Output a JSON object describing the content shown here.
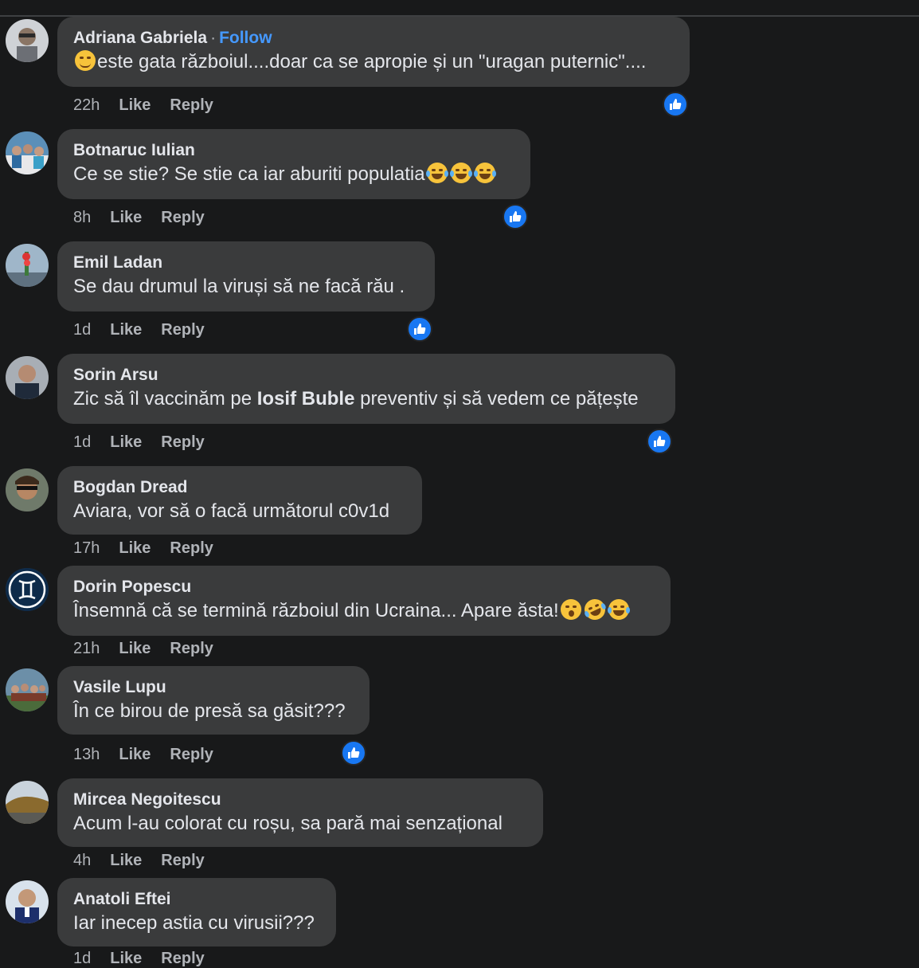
{
  "reaction_color": "#1877f2",
  "link_color": "#4599ff",
  "comments": [
    {
      "name": "Adriana Gabriela",
      "follow": "Follow",
      "text": "este gata războiul....doar ca se apropie și un \"uragan puternic\"....",
      "time": "22h",
      "like": "Like",
      "reply": "Reply",
      "reaction": "like-icon"
    },
    {
      "name": "Botnaruc Iulian",
      "text": "Ce se stie? Se stie ca iar aburiti populatia",
      "time": "8h",
      "like": "Like",
      "reply": "Reply",
      "reaction": "like-icon"
    },
    {
      "name": "Emil Ladan",
      "text": "Se dau drumul la viruși să ne facă rău .",
      "time": "1d",
      "like": "Like",
      "reply": "Reply",
      "reaction": "like-icon"
    },
    {
      "name": "Sorin Arsu",
      "text_before": "Zic să îl vaccinăm pe ",
      "text_bold": "Iosif Buble",
      "text_after": " preventiv și să vedem ce pățește",
      "time": "1d",
      "like": "Like",
      "reply": "Reply",
      "reaction": "like-icon"
    },
    {
      "name": "Bogdan Dread",
      "text": "Aviara, vor să o facă următorul c0v1d",
      "time": "17h",
      "like": "Like",
      "reply": "Reply"
    },
    {
      "name": "Dorin Popescu",
      "text": "Însemnă că se termină războiul din Ucraina... Apare ăsta!",
      "time": "21h",
      "like": "Like",
      "reply": "Reply"
    },
    {
      "name": "Vasile Lupu",
      "text": "În ce birou de presă sa găsit???",
      "time": "13h",
      "like": "Like",
      "reply": "Reply",
      "reaction": "like-icon"
    },
    {
      "name": "Mircea Negoitescu",
      "text": "Acum l-au colorat cu roșu, sa pară mai senzațional",
      "time": "4h",
      "like": "Like",
      "reply": "Reply"
    },
    {
      "name": "Anatoli Eftei",
      "text": "Iar inecep astia cu virusii???",
      "time": "1d",
      "like": "Like",
      "reply": "Reply"
    }
  ]
}
